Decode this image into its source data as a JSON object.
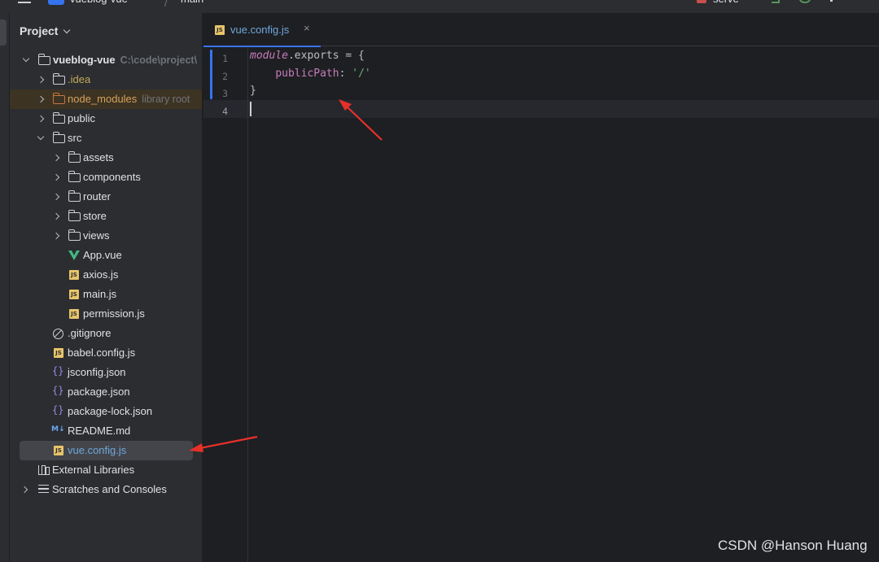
{
  "titlebar": {
    "project_name": "vueblog-vue",
    "separator": "/",
    "branch": "main",
    "run_config": "serve"
  },
  "project_panel": {
    "title": "Project",
    "tree": [
      {
        "label": "vueblog-vue",
        "sub": "C:\\code\\project\\",
        "type": "root-folder",
        "expanded": true
      },
      {
        "label": ".idea",
        "type": "folder",
        "expanded": false
      },
      {
        "label": "node_modules",
        "sub": "library root",
        "type": "folder-excluded",
        "expanded": false
      },
      {
        "label": "public",
        "type": "folder",
        "expanded": false
      },
      {
        "label": "src",
        "type": "folder",
        "expanded": true
      },
      {
        "label": "assets",
        "type": "folder",
        "expanded": false
      },
      {
        "label": "components",
        "type": "folder",
        "expanded": false
      },
      {
        "label": "router",
        "type": "folder",
        "expanded": false
      },
      {
        "label": "store",
        "type": "folder",
        "expanded": false
      },
      {
        "label": "views",
        "type": "folder",
        "expanded": false
      },
      {
        "label": "App.vue",
        "type": "vue-file"
      },
      {
        "label": "axios.js",
        "type": "js-file"
      },
      {
        "label": "main.js",
        "type": "js-file"
      },
      {
        "label": "permission.js",
        "type": "js-file"
      },
      {
        "label": ".gitignore",
        "type": "ignore-file"
      },
      {
        "label": "babel.config.js",
        "type": "js-file"
      },
      {
        "label": "jsconfig.json",
        "type": "json-file"
      },
      {
        "label": "package.json",
        "type": "json-file"
      },
      {
        "label": "package-lock.json",
        "type": "json-file"
      },
      {
        "label": "README.md",
        "type": "md-file"
      },
      {
        "label": "vue.config.js",
        "type": "js-file",
        "selected": true
      },
      {
        "label": "External Libraries",
        "type": "libraries"
      },
      {
        "label": "Scratches and Consoles",
        "type": "scratches"
      }
    ]
  },
  "editor": {
    "tab": {
      "label": "vue.config.js",
      "close": "×",
      "icon": "JS"
    },
    "line_numbers": [
      "1",
      "2",
      "3",
      "4"
    ],
    "code": {
      "line1_a": "module",
      "line1_b": ".exports = {",
      "line2_indent": "    ",
      "line2_prop": "publicPath",
      "line2_sep": ": ",
      "line2_str": "'/'",
      "line3": "}"
    }
  },
  "icons": {
    "js_badge": "JS",
    "md_badge": "M↓",
    "json_badge": "{}"
  },
  "watermark": "CSDN @Hanson Huang",
  "colors": {
    "accent": "#3574f0",
    "annotation_arrow": "#e8302a",
    "excluded_folder": "#c7773e"
  }
}
